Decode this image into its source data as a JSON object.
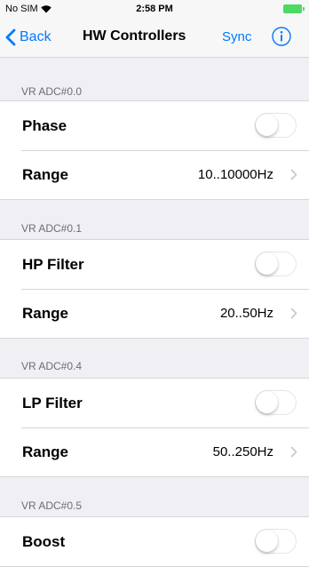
{
  "status_bar": {
    "carrier": "No SIM",
    "time": "2:58 PM"
  },
  "nav": {
    "back_label": "Back",
    "title": "HW Controllers",
    "sync_label": "Sync"
  },
  "colors": {
    "accent": "#007aff",
    "battery": "#4cd964",
    "background": "#efeff4"
  },
  "sections": [
    {
      "header": "VR ADC#0.0",
      "rows": [
        {
          "label": "Phase",
          "type": "toggle",
          "on": false
        },
        {
          "label": "Range",
          "type": "value",
          "value": "10..10000Hz"
        }
      ]
    },
    {
      "header": "VR ADC#0.1",
      "rows": [
        {
          "label": "HP Filter",
          "type": "toggle",
          "on": false
        },
        {
          "label": "Range",
          "type": "value",
          "value": "20..50Hz"
        }
      ]
    },
    {
      "header": "VR ADC#0.4",
      "rows": [
        {
          "label": "LP Filter",
          "type": "toggle",
          "on": false
        },
        {
          "label": "Range",
          "type": "value",
          "value": "50..250Hz"
        }
      ]
    },
    {
      "header": "VR ADC#0.5",
      "rows": [
        {
          "label": "Boost",
          "type": "toggle",
          "on": false
        }
      ]
    }
  ]
}
